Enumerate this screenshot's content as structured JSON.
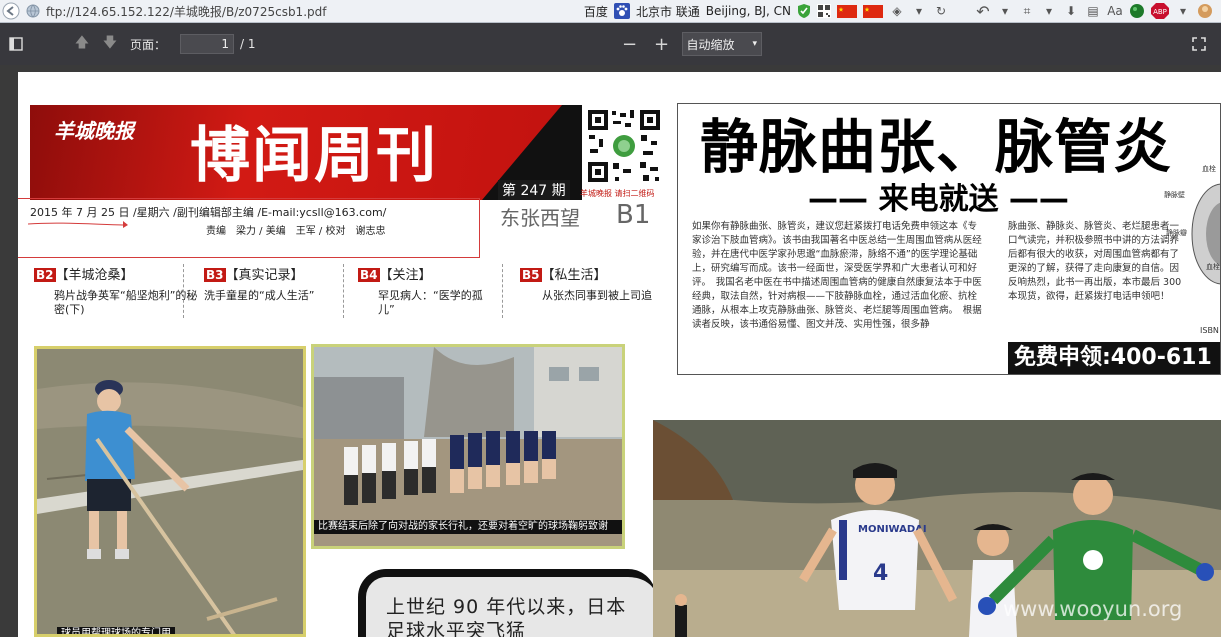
{
  "browser": {
    "url": "ftp://124.65.152.122/羊城晚报/B/z0725csb1.pdf",
    "search_engine": "百度",
    "location": "北京市 联通",
    "location_en": "Beijing, BJ, CN"
  },
  "pdf_toolbar": {
    "page_label": "页面：",
    "page_value": "1",
    "page_total": "/ 1",
    "zoom_value": "自动缩放"
  },
  "newspaper": {
    "logo": "羊城晚报",
    "masthead": "博闻周刊",
    "qr_caption": "羊城晚报 请扫二维码",
    "issue": "第 247 期",
    "section": "东张西望",
    "page": "B1",
    "dateline": "2015 年 7 月 25 日 /星期六 /副刊编辑部主编 /E-mail:ycsll@163.com/",
    "editors": "责编　梁力 / 美编　王军 / 校对　谢志忠",
    "teasers": [
      {
        "badge": "B2",
        "head": "【羊城沧桑】",
        "text": "鸦片战争英军“船坚炮利”的秘密(下)"
      },
      {
        "badge": "B3",
        "head": "【真实记录】",
        "text": "洗手童星的“成人生活”"
      },
      {
        "badge": "B4",
        "head": "【关注】",
        "text": "罕见病人：“医学的孤儿”"
      },
      {
        "badge": "B5",
        "head": "【私生活】",
        "text": "从张杰同事到被上司追"
      }
    ],
    "photo1_caption": "球员用帮理球场的专门用",
    "photo2_caption": "比赛结束后除了向对战的家长行礼，还要对着空旷的球场鞠躬致谢",
    "quote": "上世纪 90 年代以来，日本足球水平突飞猛"
  },
  "ad": {
    "title": "静脉曲张、脉管炎",
    "subtitle": "—— 来电就送 ——",
    "body1": "如果你有静脉曲张、脉管炎，建议您赶紧拨打电话免费申领这本《专家诊治下肢血管病》。该书由我国著名中医总结一生周围血管病从医经验，并在唐代中医学家孙思邈“血脉瘀滞，脉络不通”的医学理论基础上，研究编写而成。该书一经面世，深受医学界和广大患者认可和好评。　我国名老中医在书中描述周围血管病的健康自然康复法本于中医经典，取法自然，针对病根——下肢静脉血栓，通过活血化瘀、抗栓通脉，从根本上攻克静脉曲张、脉管炎、老烂腿等周围血管病。　根据读者反映，该书通俗易懂、图文并茂、实用性强，很多静",
    "body2": "脉曲张、静脉炎、脉管炎、老烂腿患者一口气读完，并积极参照书中讲的方法调养后都有很大的收获，对周围血管病都有了更深的了解，获得了走向康复的自信。因反响热烈，此书一再出版，本市最后 300 本现货，欲得，赶紧拨打电话申领吧！",
    "phone": "免费申领:400-611",
    "labels": [
      "血栓",
      "静脉壁",
      "静脉瓣",
      "血栓"
    ],
    "isbn": "ISBN"
  },
  "photo3": {
    "jersey_text": "MONIWADAI",
    "jersey_number": "4",
    "watermark": "www.wooyun.org"
  }
}
